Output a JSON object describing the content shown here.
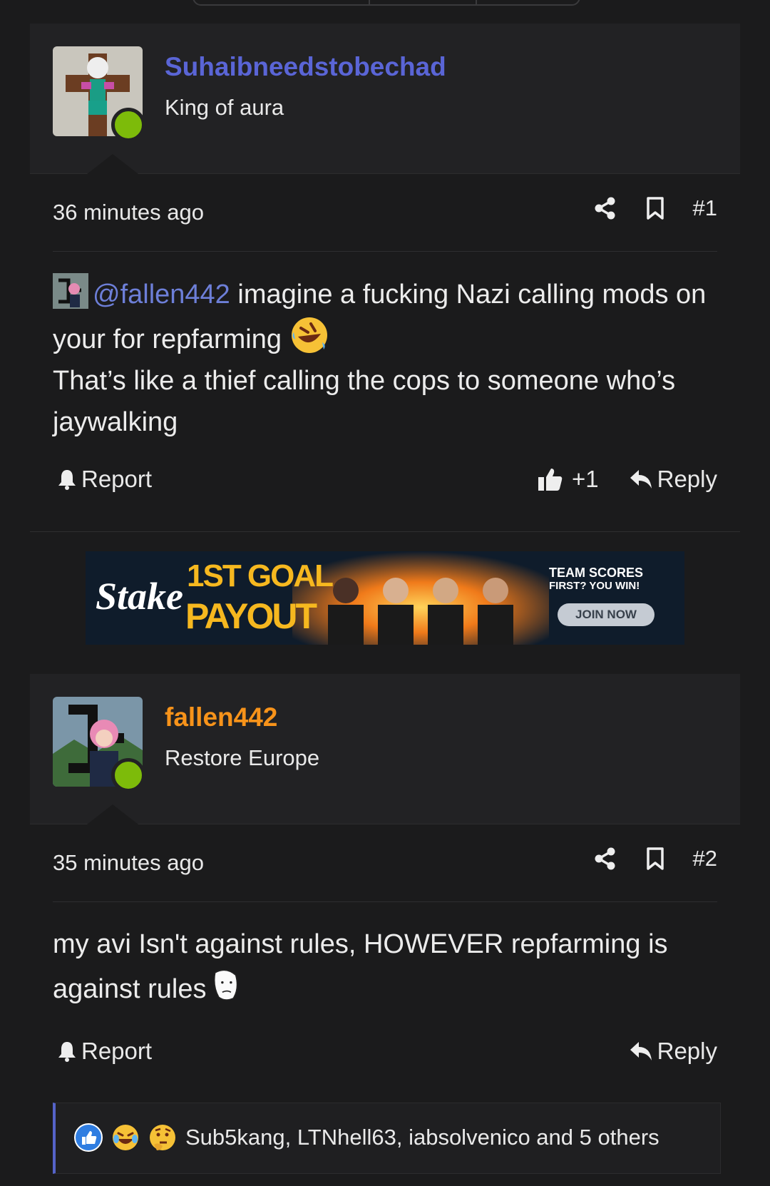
{
  "posts": [
    {
      "username": "Suhaibneedstobechad",
      "username_color": "#5a65d6",
      "user_title": "King of aura",
      "time": "36 minutes ago",
      "post_number": "#1",
      "mention": "@fallen442",
      "body_line1": " imagine a fucking Nazi calling mods on your for repfarming ",
      "body_line2": "That’s like a thief calling the cops to someone who’s jaywalking",
      "report_label": "Report",
      "like_count": "+1",
      "reply_label": "Reply"
    },
    {
      "username": "fallen442",
      "username_color": "#f7931a",
      "user_title": "Restore Europe",
      "time": "35 minutes ago",
      "post_number": "#2",
      "body": "my avi Isn't against rules, HOWEVER repfarming is against rules",
      "report_label": "Report",
      "reply_label": "Reply",
      "reactions_text": "Sub5kang, LTNhell63, iabsolvenico and 5 others"
    }
  ],
  "ad": {
    "brand": "Stake",
    "headline_1": "1ST GOAL",
    "headline_2": "PAYOUT",
    "tagline_1": "TEAM SCORES",
    "tagline_2": "FIRST? YOU WIN!",
    "cta": "JOIN NOW"
  },
  "icons": {
    "share": "share-icon",
    "bookmark": "bookmark-icon",
    "report": "bell-icon",
    "like": "thumbs-up-icon",
    "reply": "reply-arrow-icon",
    "reactions": [
      "like-reaction-icon",
      "crying-laughing-reaction-icon",
      "thinking-reaction-icon"
    ]
  }
}
